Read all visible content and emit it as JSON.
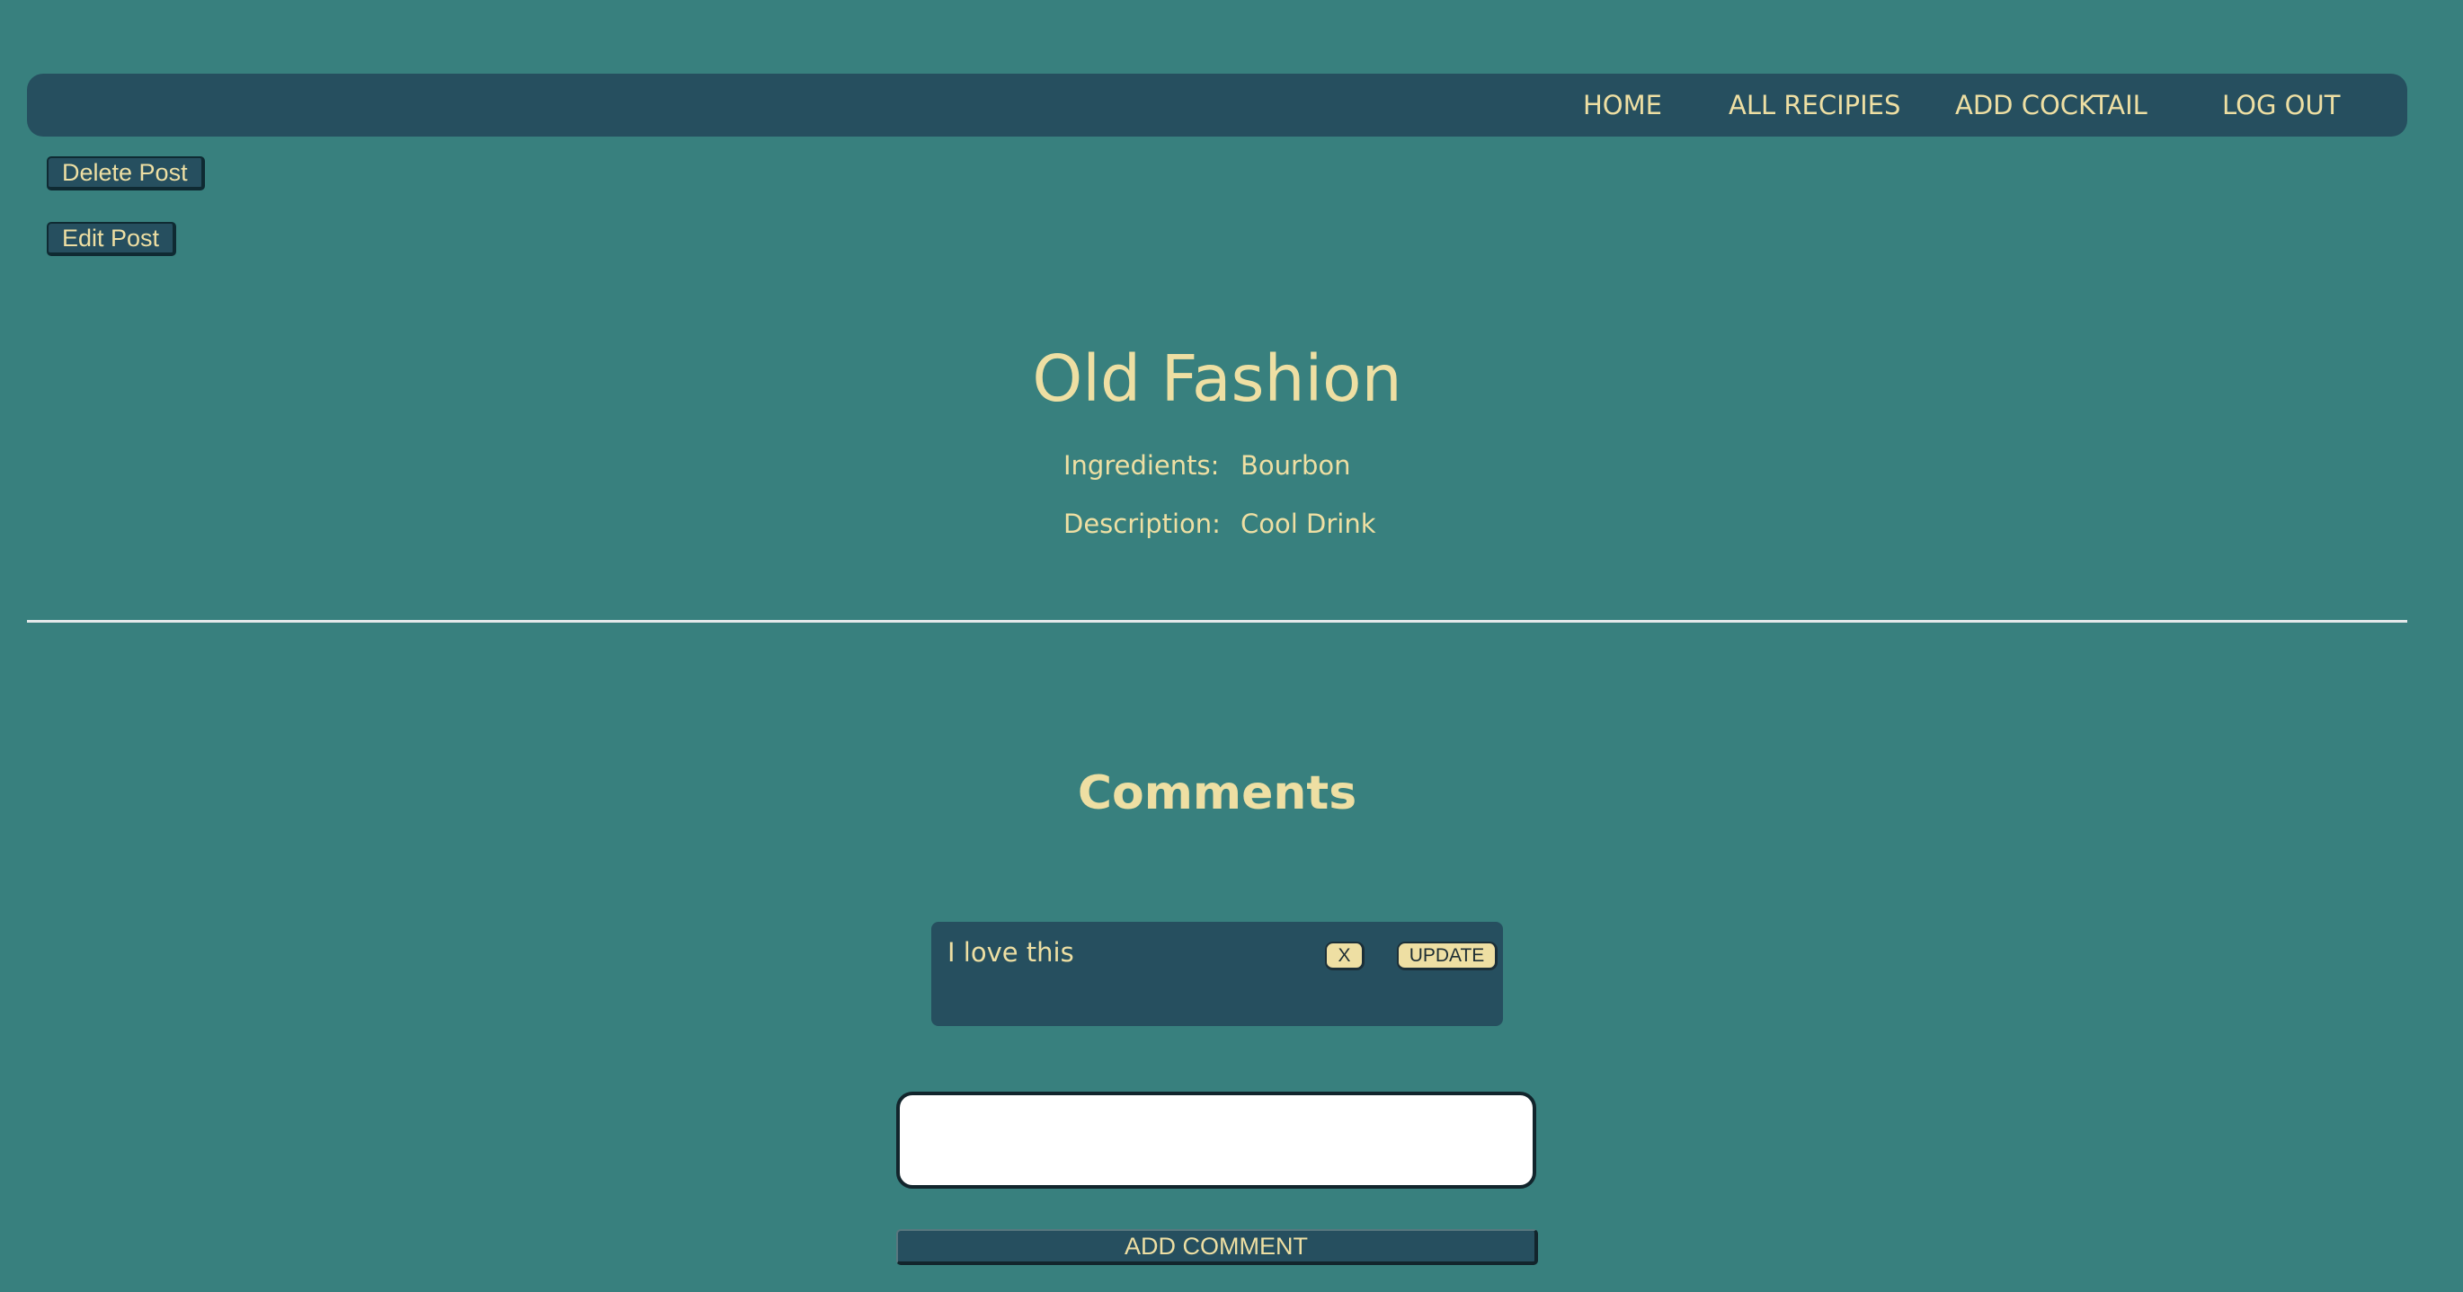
{
  "nav": {
    "items": [
      {
        "label": "HOME"
      },
      {
        "label": "ALL RECIPIES"
      },
      {
        "label": "ADD COCKTAIL"
      },
      {
        "label": "LOG OUT"
      }
    ]
  },
  "post_actions": {
    "delete_label": "Delete Post",
    "edit_label": "Edit Post"
  },
  "recipe": {
    "title": "Old Fashion",
    "ingredients_label": "Ingredients:",
    "ingredients": "Bourbon",
    "description_label": "Description:",
    "description": "Cool Drink"
  },
  "comments": {
    "heading": "Comments",
    "items": [
      {
        "text": "I love this",
        "delete_label": "X",
        "update_label": "UPDATE"
      }
    ],
    "input_value": "",
    "add_label": "ADD COMMENT"
  },
  "colors": {
    "page_background": "#38807e",
    "panel_background": "#264f5f",
    "text": "#eedfa3",
    "divider": "#e4e9ea"
  }
}
